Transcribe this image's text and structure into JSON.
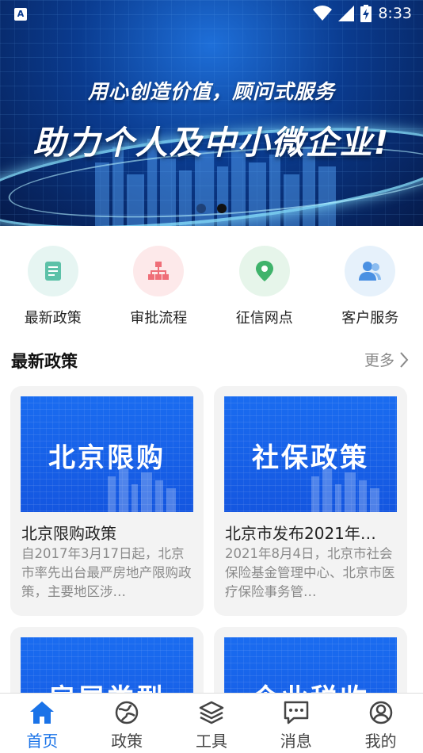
{
  "status_bar": {
    "left_icon": "a-icon",
    "left_icon_text": "A",
    "time": "8:33"
  },
  "banner": {
    "slogan_line1": "用心创造价值，顾问式服务",
    "slogan_line2": "助力个人及中小微企业!",
    "pages": 2,
    "active_page": 2
  },
  "quick_actions": [
    {
      "label": "最新政策",
      "icon": "document-icon",
      "bg": "#e6f5f2",
      "color": "#5cc1a8"
    },
    {
      "label": "审批流程",
      "icon": "org-chart-icon",
      "bg": "#fde9ea",
      "color": "#ef6e78"
    },
    {
      "label": "征信网点",
      "icon": "location-pin-icon",
      "bg": "#e6f5ea",
      "color": "#3fb36b"
    },
    {
      "label": "客户服务",
      "icon": "users-icon",
      "bg": "#e6f1fb",
      "color": "#4a90e2"
    }
  ],
  "section": {
    "title": "最新政策",
    "more": "更多"
  },
  "cards": [
    {
      "thumb_text": "北京限购",
      "title": "北京限购政策",
      "desc": "自2017年3月17日起，北京市率先出台最严房地产限购政策，主要地区涉…"
    },
    {
      "thumb_text": "社保政策",
      "title": "北京市发布2021年…",
      "desc": "2021年8月4日，北京市社会保险基金管理中心、北京市医疗保险事务管…"
    },
    {
      "thumb_text": "房屋类型",
      "title": "",
      "desc": ""
    },
    {
      "thumb_text": "企业税收",
      "title": "",
      "desc": ""
    }
  ],
  "nav": [
    {
      "label": "首页",
      "icon": "home-icon",
      "active": true
    },
    {
      "label": "政策",
      "icon": "globe-icon",
      "active": false
    },
    {
      "label": "工具",
      "icon": "layers-icon",
      "active": false
    },
    {
      "label": "消息",
      "icon": "message-icon",
      "active": false
    },
    {
      "label": "我的",
      "icon": "profile-icon",
      "active": false
    }
  ],
  "colors": {
    "accent": "#1a73e8",
    "nav_inactive": "#444444"
  }
}
